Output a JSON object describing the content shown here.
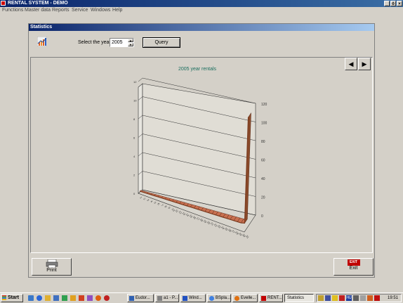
{
  "window": {
    "title": "RENTAL SYSTEM - DEMO",
    "buttons": [
      "_",
      "ő",
      "×"
    ]
  },
  "menu": [
    "Functions",
    "Master data",
    "Reports",
    "Service",
    "Windows",
    "Help"
  ],
  "panel": {
    "title": "Statistics",
    "year_label": "Select the year:",
    "year_value": "2005",
    "query_label": "Query",
    "nav_prev": "◀",
    "nav_next": "▶",
    "print_label": "Print",
    "exit_badge": "EXIT",
    "exit_label": "Exit"
  },
  "chart_data": {
    "type": "area",
    "title": "2005 year rentals",
    "xlabel": "",
    "ylabel": "",
    "x": [
      1,
      2,
      3,
      4,
      5,
      6,
      7,
      8,
      9,
      10,
      11,
      12,
      13,
      14,
      15,
      16,
      17,
      18,
      19,
      20,
      21,
      22,
      23,
      24,
      25,
      26,
      27,
      28,
      29,
      30,
      31
    ],
    "values": [
      1,
      1,
      1,
      1,
      1,
      1,
      1,
      1,
      1,
      1,
      1,
      1,
      1,
      1,
      1,
      1,
      1,
      1,
      1,
      1,
      1,
      1,
      1,
      1,
      1,
      1,
      1,
      1,
      1,
      2,
      117
    ],
    "ylim": [
      0,
      120
    ],
    "right_ticks": [
      "0",
      "20",
      "40",
      "60",
      "80",
      "100",
      "120"
    ],
    "left_ticks": [
      "0",
      "2",
      "4",
      "6",
      "8",
      "10",
      "12"
    ],
    "grid": true,
    "projection": "3d",
    "series_color": "#7a3a1e"
  },
  "taskbar": {
    "start": "Start",
    "tasks": [
      {
        "label": "Eudor...",
        "active": false
      },
      {
        "label": "a1 - P...",
        "active": false
      },
      {
        "label": "Wind...",
        "active": false
      },
      {
        "label": "BSpla...",
        "active": false
      },
      {
        "label": "Evelle...",
        "active": false
      },
      {
        "label": "RENT...",
        "active": false
      },
      {
        "label": "Statistics",
        "active": true
      }
    ],
    "tray_icons": [
      "speaker-icon",
      "network-icon",
      "shield-icon",
      "antivirus-icon",
      "hu-language-icon",
      "usb-icon",
      "printer-icon",
      "security-icon",
      "acrobat-icon"
    ],
    "tray_lang": "HU",
    "clock": "19:51"
  }
}
